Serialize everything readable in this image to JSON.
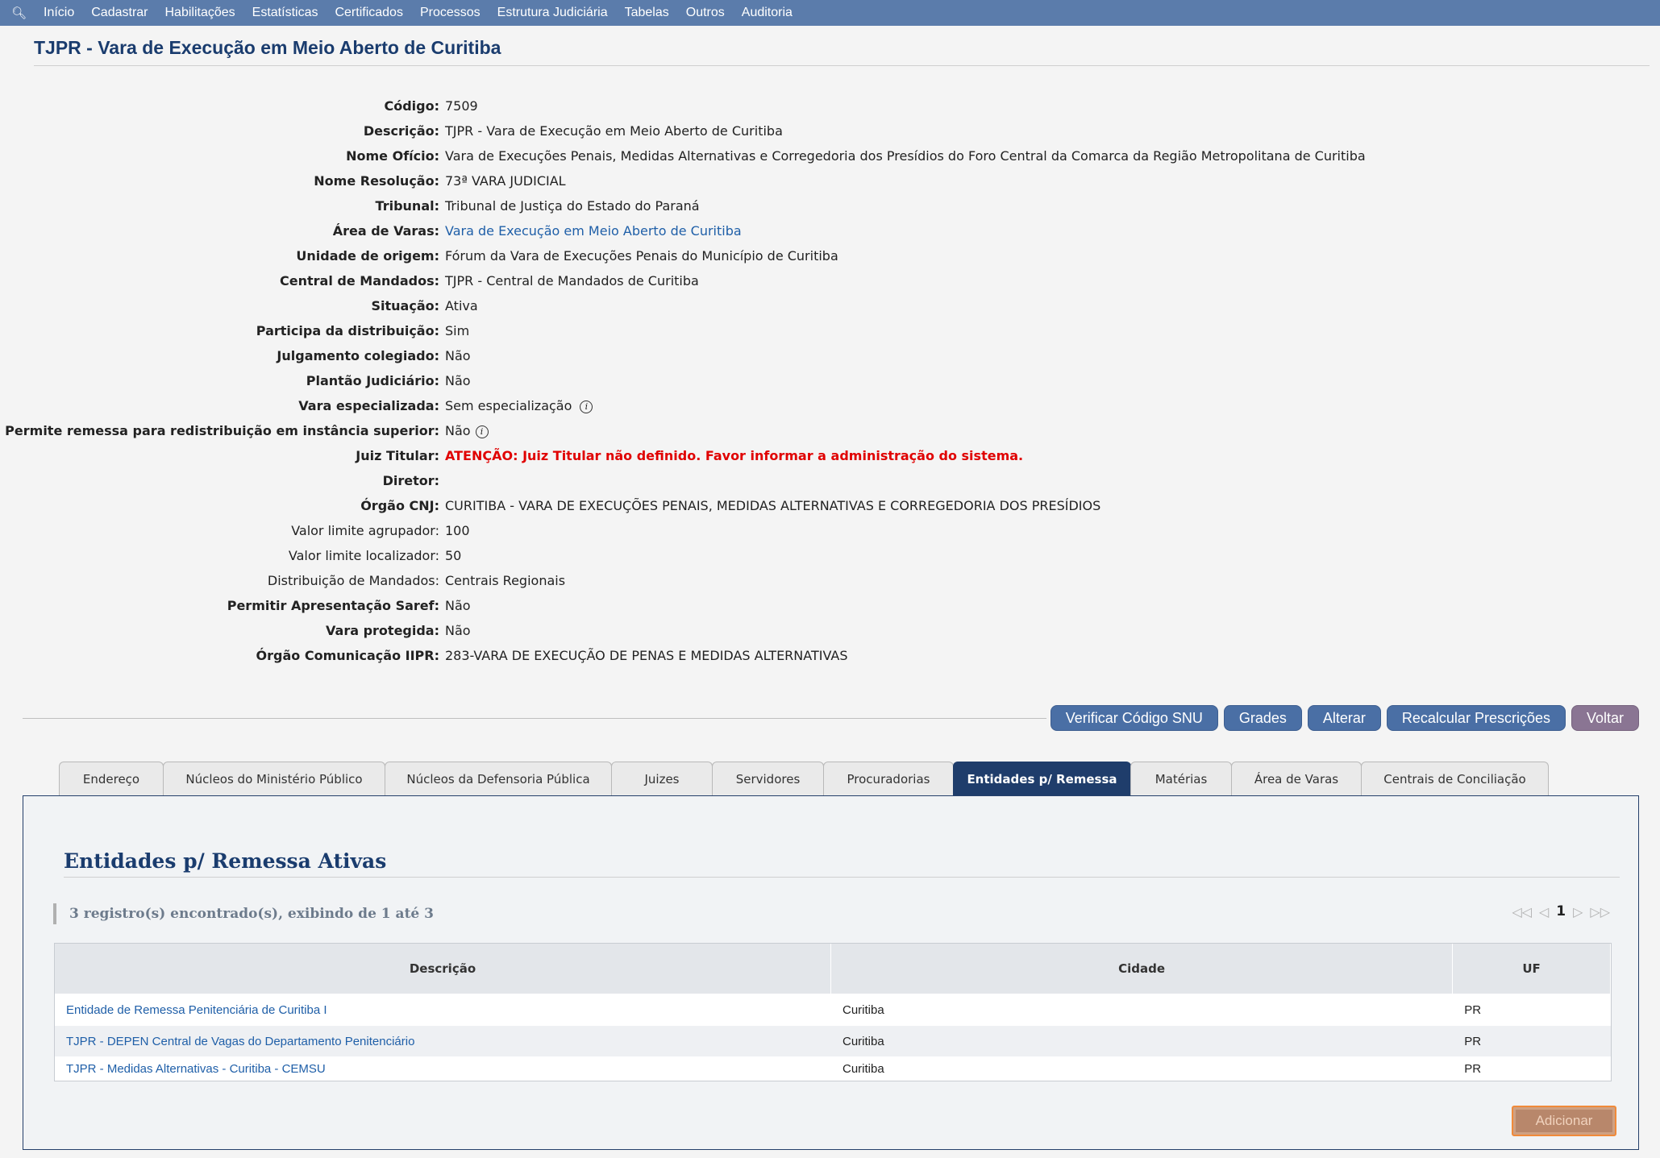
{
  "menu": {
    "items": [
      "Início",
      "Cadastrar",
      "Habilitações",
      "Estatísticas",
      "Certificados",
      "Processos",
      "Estrutura Judiciária",
      "Tabelas",
      "Outros",
      "Auditoria"
    ]
  },
  "page": {
    "title": "TJPR - Vara de Execução em Meio Aberto de Curitiba"
  },
  "fields": [
    {
      "label": "Código:",
      "value": "7509"
    },
    {
      "label": "Descrição:",
      "value": "TJPR - Vara de Execução em Meio Aberto de Curitiba"
    },
    {
      "label": "Nome Ofício:",
      "value": "Vara de Execuções Penais, Medidas Alternativas e Corregedoria dos Presídios do Foro Central da Comarca da Região Metropolitana de Curitiba"
    },
    {
      "label": "Nome Resolução:",
      "value": "73ª VARA JUDICIAL"
    },
    {
      "label": "Tribunal:",
      "value": "Tribunal de Justiça do Estado do Paraná"
    },
    {
      "label": "Área de Varas:",
      "value": "Vara de Execução em Meio Aberto de Curitiba"
    },
    {
      "label": "Unidade de origem:",
      "value": "Fórum da Vara de Execuções Penais do Município de Curitiba"
    },
    {
      "label": "Central de Mandados:",
      "value": "TJPR - Central de Mandados de Curitiba"
    },
    {
      "label": "Situação:",
      "value": "Ativa"
    },
    {
      "label": "Participa da distribuição:",
      "value": "Sim"
    },
    {
      "label": "Julgamento colegiado:",
      "value": "Não"
    },
    {
      "label": "Plantão Judiciário:",
      "value": "Não"
    },
    {
      "label": "Vara especializada:",
      "value": "Sem especialização"
    },
    {
      "label": "Permite remessa para redistribuição em instância superior:",
      "value": "Não"
    },
    {
      "label": "Juiz Titular:",
      "value": "ATENÇÃO: Juiz Titular não definido. Favor informar a administração do sistema."
    },
    {
      "label": "Diretor:",
      "value": ""
    },
    {
      "label": "Órgão CNJ:",
      "value": "CURITIBA - VARA DE EXECUÇÕES PENAIS, MEDIDAS ALTERNATIVAS E CORREGEDORIA DOS PRESÍDIOS"
    },
    {
      "label": "Valor limite agrupador:",
      "value": "100"
    },
    {
      "label": "Valor limite localizador:",
      "value": "50"
    },
    {
      "label": "Distribuição de Mandados:",
      "value": "Centrais Regionais"
    },
    {
      "label": "Permitir Apresentação Saref:",
      "value": "Não"
    },
    {
      "label": "Vara protegida:",
      "value": "Não"
    },
    {
      "label": "Órgão Comunicação IIPR:",
      "value": "283-VARA DE EXECUÇÃO DE PENAS E MEDIDAS ALTERNATIVAS"
    }
  ],
  "actions": {
    "verificar": "Verificar Código SNU",
    "grades": "Grades",
    "alterar": "Alterar",
    "recalcular": "Recalcular Prescrições",
    "voltar": "Voltar"
  },
  "tabs": [
    {
      "label": "Endereço"
    },
    {
      "label": "Núcleos do Ministério Público"
    },
    {
      "label": "Núcleos da Defensoria Pública"
    },
    {
      "label": "Juizes"
    },
    {
      "label": "Servidores"
    },
    {
      "label": "Procuradorias"
    },
    {
      "label": "Entidades p/ Remessa",
      "active": true
    },
    {
      "label": "Matérias"
    },
    {
      "label": "Área de Varas"
    },
    {
      "label": "Centrais de Conciliação"
    }
  ],
  "panel": {
    "title": "Entidades p/ Remessa Ativas",
    "records_text": "3 registro(s) encontrado(s), exibindo de 1 até 3",
    "pager": {
      "page": "1"
    },
    "table": {
      "headers": [
        "Descrição",
        "Cidade",
        "UF"
      ],
      "rows": [
        [
          "Entidade de Remessa Penitenciária de Curitiba I",
          "Curitiba",
          "PR"
        ],
        [
          "TJPR - DEPEN Central de Vagas do Departamento Penitenciário",
          "Curitiba",
          "PR"
        ],
        [
          "TJPR - Medidas Alternativas - Curitiba - CEMSU",
          "Curitiba",
          "PR"
        ]
      ]
    },
    "add_label": "Adicionar"
  }
}
